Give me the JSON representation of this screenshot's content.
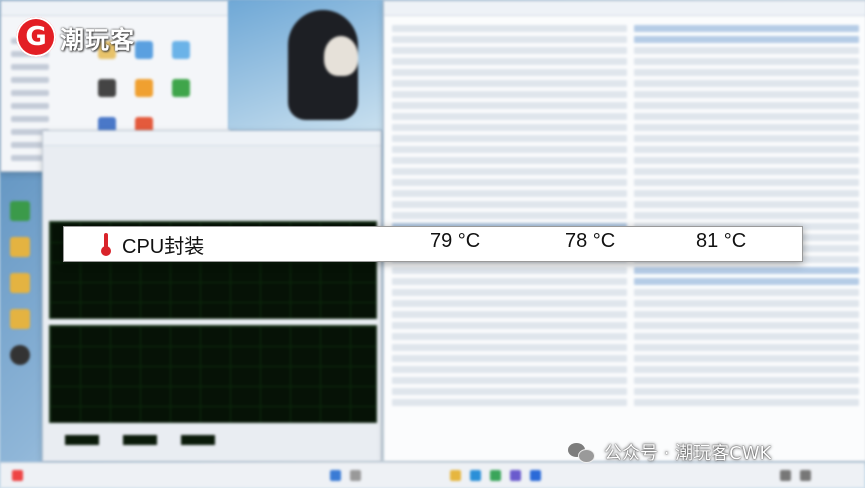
{
  "logo": {
    "mark": "G",
    "text": "潮玩客"
  },
  "highlight_row": {
    "icon": "thermometer-icon",
    "label": "CPU封装",
    "current": "79 °C",
    "minimum": "78 °C",
    "maximum": "81 °C"
  },
  "watermark": {
    "icon": "wechat-icon",
    "text": "公众号 · 潮玩客CWK"
  },
  "colors": {
    "logo_red": "#e31e24",
    "thermometer_red": "#d9232a",
    "graph_background": "#061206"
  }
}
